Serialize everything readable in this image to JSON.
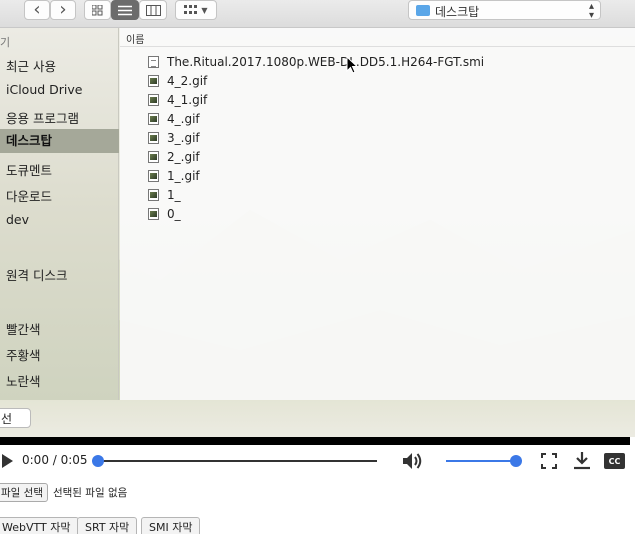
{
  "dialog": {
    "toolbar": {
      "back_glyph": "‹",
      "forward_glyph": "›",
      "icon_view": "grid-icon",
      "list_view": "list-icon",
      "column_view": "columns-icon",
      "group_menu": "group-icon",
      "path_popup_label": "데스크탑"
    },
    "sidebar": {
      "header": "기",
      "items": [
        {
          "label": "최근 사용"
        },
        {
          "label": "iCloud Drive"
        },
        {
          "label": "응용 프로그램"
        },
        {
          "label": "데스크탑",
          "selected": true
        },
        {
          "label": "도큐멘트"
        },
        {
          "label": "다운로드"
        },
        {
          "label": "dev"
        },
        {
          "label": "원격 디스크"
        },
        {
          "label": "빨간색"
        },
        {
          "label": "주황색"
        },
        {
          "label": "노란색"
        }
      ]
    },
    "file_list": {
      "column_header": "이름",
      "files": [
        {
          "name": "The.Ritual.2017.1080p.WEB-DL.DD5.1.H264-FGT.smi",
          "kind": "document"
        },
        {
          "name": "4_2.gif",
          "kind": "image"
        },
        {
          "name": "4_1.gif",
          "kind": "image"
        },
        {
          "name": "4_.gif",
          "kind": "image"
        },
        {
          "name": "3_.gif",
          "kind": "image"
        },
        {
          "name": "2_.gif",
          "kind": "image"
        },
        {
          "name": "1_.gif",
          "kind": "image"
        },
        {
          "name": "1_",
          "kind": "image"
        },
        {
          "name": "0_",
          "kind": "image"
        }
      ]
    },
    "footer": {
      "select_label": "선"
    }
  },
  "player": {
    "time_display": "0:00 / 0:05",
    "progress": 0,
    "volume": 1.0,
    "accent_color": "#3b78e7"
  },
  "file_input": {
    "button_label": "파일 선택",
    "status": "선택된 파일 없음"
  },
  "subtitle_buttons": [
    "WebVTT 자막",
    "SRT 자막",
    "SMI 자막"
  ]
}
